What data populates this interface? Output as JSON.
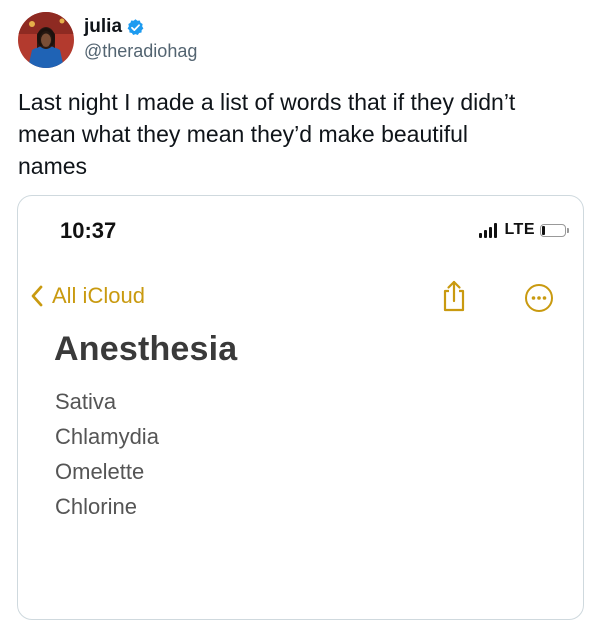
{
  "tweet": {
    "author_name": "julia",
    "handle": "@theradiohag",
    "text": "Last night I made a list of words that if they didn’t\nmean what they mean they’d make beautiful\nnames"
  },
  "screenshot": {
    "status_bar": {
      "time": "10:37",
      "network": "LTE"
    },
    "nav": {
      "back_label": "All iCloud"
    },
    "note": {
      "title": "Anesthesia",
      "lines": [
        "Sativa",
        "Chlamydia",
        "Omelette",
        "Chlorine"
      ]
    },
    "accent_color": "#c99a10"
  },
  "icons": {
    "verified": "verified-badge-icon",
    "back": "chevron-left-icon",
    "share": "share-icon",
    "more": "more-circle-icon"
  }
}
